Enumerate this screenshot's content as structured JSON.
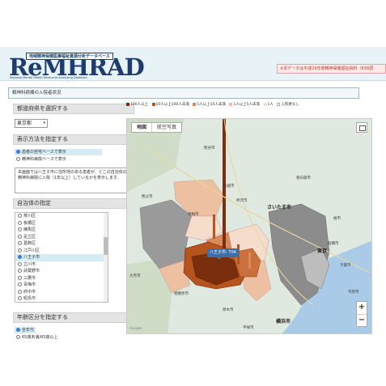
{
  "header": {
    "subtitle": "地域精神保健医療福祉資源分析データベース",
    "logo": "ReMHRAD",
    "logo_en": "Regional Mental Health Resources Analyzing Database",
    "notice": "※本データは平成29年度精神保健福祉資料（630調"
  },
  "page_title": "精神科病棟の入院者状況",
  "sidebar": {
    "prefecture_head": "都道府県を選択する",
    "prefecture_value": "東京都",
    "display_head": "表示方法を指定する",
    "display_options": [
      {
        "label": "患者の自宅ベースで表示",
        "selected": true
      },
      {
        "label": "精神科病院ベースで表示",
        "selected": false
      }
    ],
    "info_text": "本画面では八王子市に住所地のある患者が、どこの自治体の精神科病院に入院（1年以上）しているかを表示します。",
    "municipality_head": "自治体の指定",
    "municipalities": [
      {
        "label": "荒川区",
        "selected": false
      },
      {
        "label": "板橋区",
        "selected": false
      },
      {
        "label": "練馬区",
        "selected": false
      },
      {
        "label": "足立区",
        "selected": false
      },
      {
        "label": "葛飾区",
        "selected": false
      },
      {
        "label": "江戸川区",
        "selected": false
      },
      {
        "label": "八王子市",
        "selected": true
      },
      {
        "label": "立川市",
        "selected": false
      },
      {
        "label": "武蔵野市",
        "selected": false
      },
      {
        "label": "三鷹市",
        "selected": false
      },
      {
        "label": "青梅市",
        "selected": false
      },
      {
        "label": "府中市",
        "selected": false
      },
      {
        "label": "昭島市",
        "selected": false
      }
    ],
    "age_head": "年齢区分を指定する",
    "age_options": [
      {
        "label": "全年代",
        "selected": true
      },
      {
        "label": "65歳未満/65歳以上",
        "selected": false
      }
    ]
  },
  "legend": [
    {
      "label": "100人以上",
      "color": "#7a2e0e"
    },
    {
      "label": "10人以上100人未満",
      "color": "#b5541c"
    },
    {
      "label": "5人以上10人未満",
      "color": "#d98a5a"
    },
    {
      "label": "1人以上5人未満",
      "color": "#ecc0a0"
    },
    {
      "label": "1人",
      "color": "#f5dccb"
    },
    {
      "label": "入院者なし",
      "color": "#ffffff"
    }
  ],
  "map": {
    "tab_map": "地図",
    "tab_satellite": "航空写真",
    "popup": "八王子市: 704",
    "zoom_in": "+",
    "zoom_out": "−",
    "labels": {
      "saitama": "さいたま市",
      "tokyo": "東京",
      "yokohama": "横浜市",
      "kumagaya": "熊谷市",
      "kawagoe": "川越市",
      "ome": "青梅市",
      "kasukabe": "春日部市",
      "kashiwa": "柏市",
      "sagamihara": "相模原市",
      "ichihara": "市原市",
      "funabashi": "船橋市",
      "atsugi": "厚木市",
      "tokorozawa": "所沢市",
      "chichibu": "秩父市",
      "oume": "大月市",
      "hiratsuka": "平塚市",
      "chiba": "千葉市"
    },
    "attribution": "Google"
  }
}
